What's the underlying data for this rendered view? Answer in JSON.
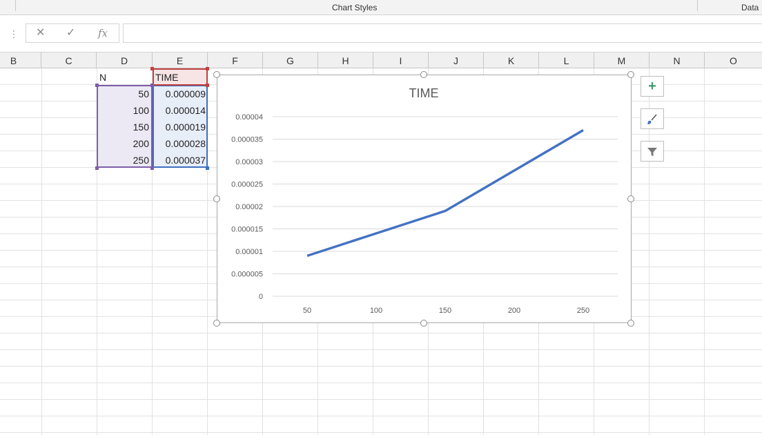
{
  "ribbon": {
    "group_chart_styles": "Chart Styles",
    "group_data": "Data"
  },
  "formula_bar": {
    "cancel_icon": "close-icon",
    "enter_icon": "check-icon",
    "fx_label": "fx",
    "value": ""
  },
  "columns": [
    "B",
    "C",
    "D",
    "E",
    "F",
    "G",
    "H",
    "I",
    "J",
    "K",
    "L",
    "M",
    "N",
    "O"
  ],
  "sheet": {
    "header_n": "N",
    "header_time": "TIME",
    "rows": [
      {
        "n": "50",
        "time": "0.000009"
      },
      {
        "n": "100",
        "time": "0.000014"
      },
      {
        "n": "150",
        "time": "0.000019"
      },
      {
        "n": "200",
        "time": "0.000028"
      },
      {
        "n": "250",
        "time": "0.000037"
      }
    ]
  },
  "chart_tools": {
    "elements_icon": "plus-icon",
    "styles_icon": "paintbrush-icon",
    "filter_icon": "funnel-icon"
  },
  "colors": {
    "series": "#4472C4",
    "range_n": "#7E5CA8",
    "range_time": "#3D6FBF",
    "header_time": "#C04040",
    "elements_plus": "#3C9A6C"
  },
  "chart_data": {
    "type": "line",
    "title": "TIME",
    "categories": [
      "50",
      "100",
      "150",
      "200",
      "250"
    ],
    "series": [
      {
        "name": "TIME",
        "values": [
          9e-06,
          1.4e-05,
          1.9e-05,
          2.8e-05,
          3.7e-05
        ]
      }
    ],
    "yticks": [
      "0",
      "0.000005",
      "0.00001",
      "0.000015",
      "0.00002",
      "0.000025",
      "0.00003",
      "0.000035",
      "0.00004"
    ],
    "ylim": [
      0,
      4e-05
    ],
    "xlabel": "",
    "ylabel": "",
    "grid": true,
    "legend": "none"
  }
}
